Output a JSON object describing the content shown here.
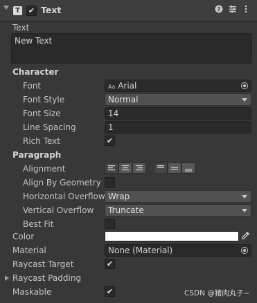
{
  "header": {
    "title": "Text",
    "component_icon_letter": "T",
    "enabled_mark": "✔",
    "icons": [
      "help-icon",
      "preset-icon",
      "kebab-menu-icon"
    ]
  },
  "text_field": {
    "label": "Text",
    "value": "New Text"
  },
  "character": {
    "section": "Character",
    "font": {
      "label": "Font",
      "value": "Arial",
      "icon_text": "Aa"
    },
    "font_style": {
      "label": "Font Style",
      "value": "Normal"
    },
    "font_size": {
      "label": "Font Size",
      "value": "14"
    },
    "line_spacing": {
      "label": "Line Spacing",
      "value": "1"
    },
    "rich_text": {
      "label": "Rich Text",
      "checked_mark": "✔"
    }
  },
  "paragraph": {
    "section": "Paragraph",
    "alignment": {
      "label": "Alignment"
    },
    "align_by_geometry": {
      "label": "Align By Geometry"
    },
    "horizontal_overflow": {
      "label": "Horizontal Overflow",
      "value": "Wrap"
    },
    "vertical_overflow": {
      "label": "Vertical Overflow",
      "value": "Truncate"
    },
    "best_fit": {
      "label": "Best Fit"
    }
  },
  "color": {
    "label": "Color",
    "value_hex": "#ffffff"
  },
  "material": {
    "label": "Material",
    "value": "None (Material)"
  },
  "raycast_target": {
    "label": "Raycast Target",
    "checked_mark": "✔"
  },
  "raycast_padding": {
    "label": "Raycast Padding"
  },
  "maskable": {
    "label": "Maskable",
    "checked_mark": "✔"
  },
  "watermark": "CSDN @猪肉丸子~"
}
